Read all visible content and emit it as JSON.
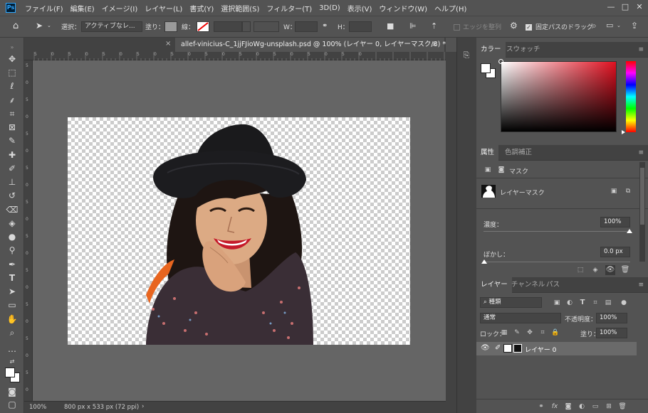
{
  "app": {
    "logo": "Ps"
  },
  "menu": [
    "ファイル(F)",
    "編集(E)",
    "イメージ(I)",
    "レイヤー(L)",
    "書式(Y)",
    "選択範囲(S)",
    "フィルター(T)",
    "3D(D)",
    "表示(V)",
    "ウィンドウ(W)",
    "ヘルプ(H)"
  ],
  "window": {
    "minimize": "—",
    "maximize": "□",
    "close": "✕"
  },
  "options": {
    "select_label": "選択：",
    "select_value": "アクティブなレ...",
    "fill_label": "塗り：",
    "stroke_label": "線：",
    "w_label": "W：",
    "h_label": "H：",
    "align_edges": "エッジを整列",
    "constrain_path": "固定パスのドラッグ"
  },
  "document": {
    "tab_title": "allef-vinicius-C_1jjFJioWg-unsplash.psd @ 100% (レイヤー 0, レイヤーマスク/8) *",
    "close": "×"
  },
  "ruler": {
    "top": [
      "5",
      "0",
      "5",
      "0",
      "5",
      "0",
      "5",
      "0",
      "5",
      "0",
      "5",
      "0",
      "5",
      "0",
      "5",
      "0",
      "5",
      "0",
      "5",
      "0"
    ],
    "left": [
      "5",
      "0",
      "5",
      "0",
      "5",
      "0",
      "5",
      "0",
      "5",
      "0",
      "5",
      "0",
      "5",
      "0",
      "5",
      "0",
      "5",
      "0",
      "5",
      "0"
    ]
  },
  "status": {
    "zoom": "100%",
    "size": "800 px x 533 px (72 ppi)",
    "arrow": "›"
  },
  "color_panel": {
    "tabs": [
      "カラー",
      "スウォッチ"
    ],
    "hue_color": "#e01020"
  },
  "properties_panel": {
    "tabs": [
      "属性",
      "色調補正"
    ],
    "mask_header": "マスク",
    "layer_mask_label": "レイヤーマスク",
    "density_label": "濃度：",
    "density_value": "100%",
    "feather_label": "ぼかし：",
    "feather_value": "0.0 px"
  },
  "layers_panel": {
    "tabs": [
      "レイヤー",
      "チャンネル",
      "パス"
    ],
    "filter_kind": "種類",
    "blend_mode": "通常",
    "opacity_label": "不透明度：",
    "opacity_value": "100%",
    "lock_label": "ロック：",
    "fill_label": "塗り：",
    "fill_value": "100%",
    "layer_name": "レイヤー 0"
  }
}
